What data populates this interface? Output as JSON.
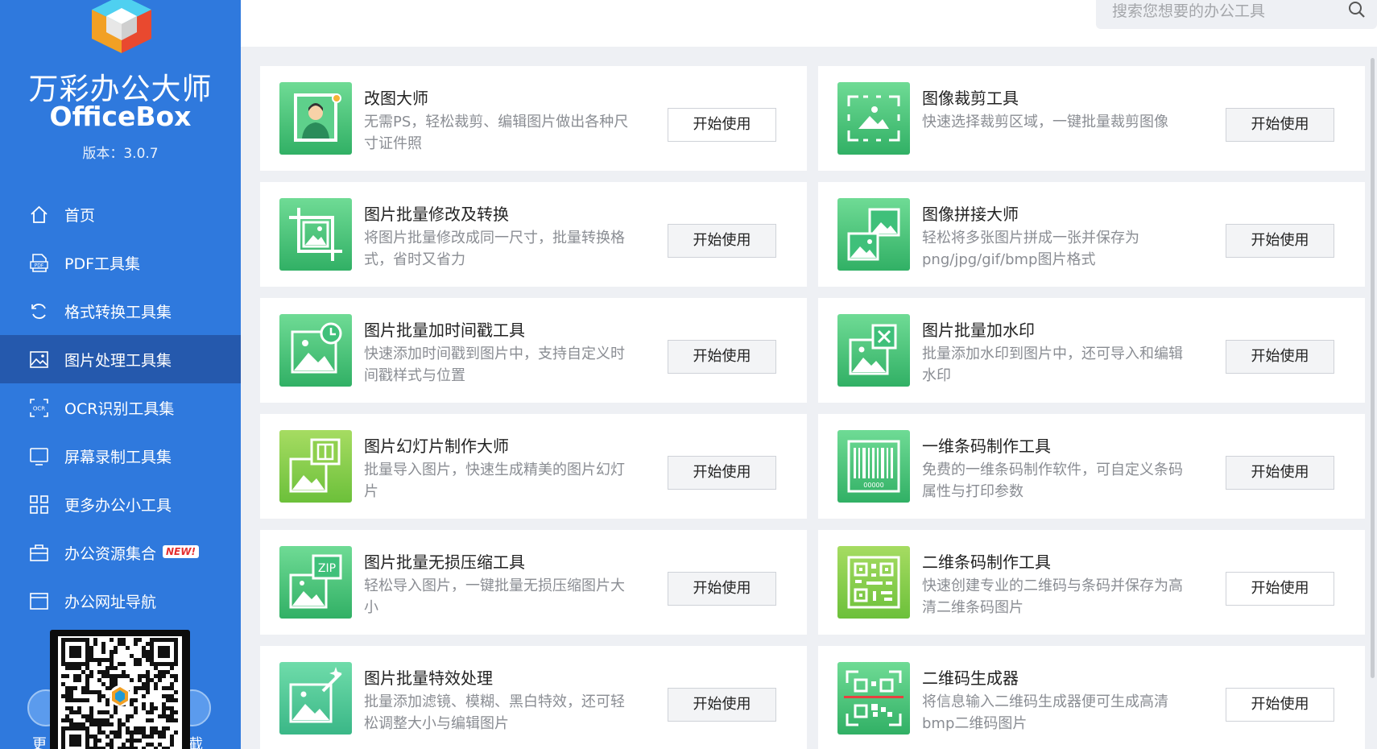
{
  "app": {
    "title": "万彩办公大师",
    "subtitle": "OfficeBox",
    "version": "版本：3.0.7"
  },
  "sidebar": {
    "items": [
      {
        "label": "首页",
        "icon": "home-icon"
      },
      {
        "label": "PDF工具集",
        "icon": "pdf-icon"
      },
      {
        "label": "格式转换工具集",
        "icon": "refresh-icon"
      },
      {
        "label": "图片处理工具集",
        "icon": "image-icon"
      },
      {
        "label": "OCR识别工具集",
        "icon": "ocr-icon"
      },
      {
        "label": "屏幕录制工具集",
        "icon": "monitor-icon"
      },
      {
        "label": "更多办公小工具",
        "icon": "grid-icon"
      },
      {
        "label": "办公资源集合",
        "icon": "briefcase-icon",
        "badge": "NEW!"
      },
      {
        "label": "办公网址导航",
        "icon": "browser-icon"
      }
    ],
    "active_index": 3,
    "bottom_left_cut": "更",
    "bottom_right_cut": "截"
  },
  "search": {
    "placeholder": "搜索您想要的办公工具"
  },
  "colors": {
    "sidebar": "#2f79dd",
    "sidebar_active": "#2559ad",
    "tile_green_a": "#5fd38a",
    "tile_green_b": "#36b36b",
    "badge_text": "#e53030"
  },
  "tools": [
    {
      "title": "改图大师",
      "desc": "无需PS，轻松裁剪、编辑图片做出各种尺寸证件照",
      "button": "开始使用",
      "icon": "portrait-icon"
    },
    {
      "title": "图像裁剪工具",
      "desc": "快速选择裁剪区域，一键批量裁剪图像",
      "button": "开始使用",
      "icon": "crop-frame-icon"
    },
    {
      "title": "图片批量修改及转换",
      "desc": "将图片批量修改成同一尺寸，批量转换格式，省时又省力",
      "button": "开始使用",
      "icon": "crop-image-icon"
    },
    {
      "title": "图像拼接大师",
      "desc": "轻松将多张图片拼成一张并保存为png/jpg/gif/bmp图片格式",
      "button": "开始使用",
      "icon": "stitch-images-icon"
    },
    {
      "title": "图片批量加时间戳工具",
      "desc": "快速添加时间戳到图片中，支持自定义时间戳样式与位置",
      "button": "开始使用",
      "icon": "timestamp-image-icon"
    },
    {
      "title": "图片批量加水印",
      "desc": "批量添加水印到图片中，还可导入和编辑水印",
      "button": "开始使用",
      "icon": "watermark-image-icon"
    },
    {
      "title": "图片幻灯片制作大师",
      "desc": "批量导入图片，快速生成精美的图片幻灯片",
      "button": "开始使用",
      "icon": "slideshow-image-icon"
    },
    {
      "title": "一维条码制作工具",
      "desc": "免费的一维条码制作软件，可自定义条码属性与打印参数",
      "button": "开始使用",
      "icon": "barcode-icon"
    },
    {
      "title": "图片批量无损压缩工具",
      "desc": "轻松导入图片，一键批量无损压缩图片大小",
      "button": "开始使用",
      "icon": "zip-image-icon"
    },
    {
      "title": "二维条码制作工具",
      "desc": "快速创建专业的二维码与条码并保存为高清二维条码图片",
      "button": "开始使用",
      "icon": "qrcode-barcode-icon"
    },
    {
      "title": "图片批量特效处理",
      "desc": "批量添加滤镜、模糊、黑白特效，还可轻松调整大小与编辑图片",
      "button": "开始使用",
      "icon": "effects-image-icon"
    },
    {
      "title": "二维码生成器",
      "desc": "将信息输入二维码生成器便可生成高清bmp二维码图片",
      "button": "开始使用",
      "icon": "qrcode-scan-icon"
    }
  ]
}
